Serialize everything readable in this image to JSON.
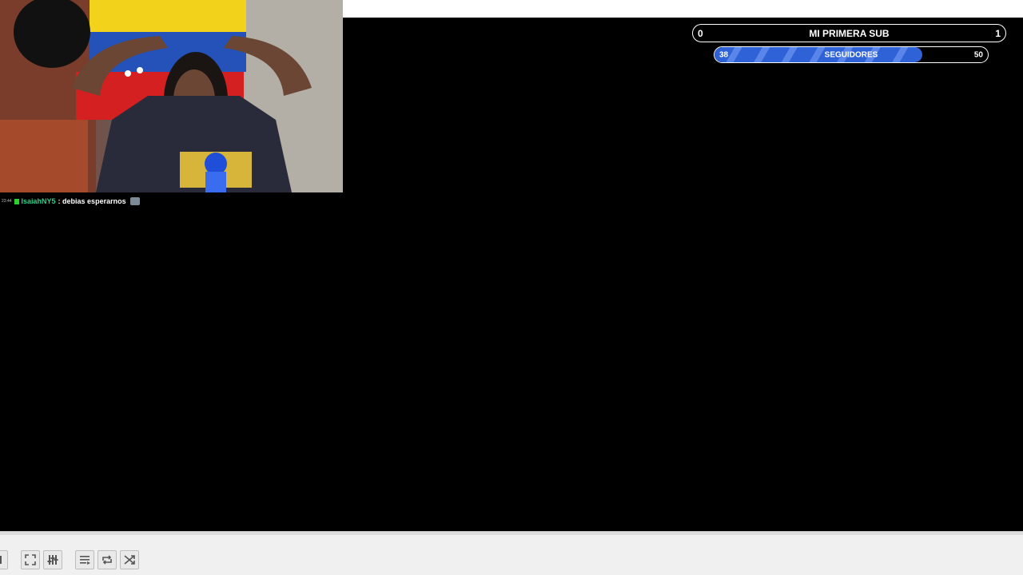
{
  "chat": {
    "time": "23:44",
    "username": "IsaiahNY5",
    "message": ": debias esperarnos"
  },
  "goals": {
    "sub": {
      "title": "MI PRIMERA SUB",
      "min": "0",
      "max": "1",
      "progress": 0
    },
    "followers": {
      "title": "SEGUIDORES",
      "min": "38",
      "max": "50",
      "progress": 0.76
    }
  },
  "controls": {
    "buttons": [
      "skip-icon",
      "fullscreen-icon",
      "equalizer-icon",
      "playlist-icon",
      "loop-icon",
      "shuffle-icon"
    ]
  },
  "colors": {
    "goal_fill": "#2f62d6",
    "chat_user": "#27d08a",
    "background": "#000000"
  }
}
